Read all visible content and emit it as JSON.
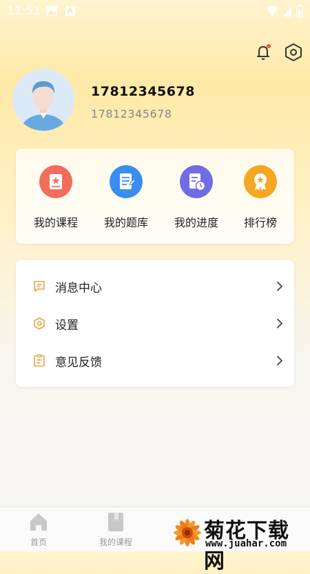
{
  "status_bar": {
    "time": "11:51"
  },
  "profile": {
    "name": "17812345678",
    "phone": "17812345678"
  },
  "quick_actions": [
    {
      "label": "我的课程",
      "icon": "course-icon",
      "color": "#f26d5b"
    },
    {
      "label": "我的题库",
      "icon": "question-bank-icon",
      "color": "#3a8ef0"
    },
    {
      "label": "我的进度",
      "icon": "progress-icon",
      "color": "#6e6de6"
    },
    {
      "label": "排行榜",
      "icon": "ranking-icon",
      "color": "#f5a623"
    }
  ],
  "menu": [
    {
      "label": "消息中心",
      "icon": "message-icon"
    },
    {
      "label": "设置",
      "icon": "settings-icon"
    },
    {
      "label": "意见反馈",
      "icon": "feedback-icon"
    }
  ],
  "tabbar": [
    {
      "label": "首页",
      "icon": "home-icon"
    },
    {
      "label": "我的课程",
      "icon": "book-icon"
    }
  ],
  "watermark": {
    "title": "菊花下载网",
    "url": "www.juahar.com"
  },
  "colors": {
    "accent": "#f5a623",
    "background_top": "#ffe9a8"
  }
}
